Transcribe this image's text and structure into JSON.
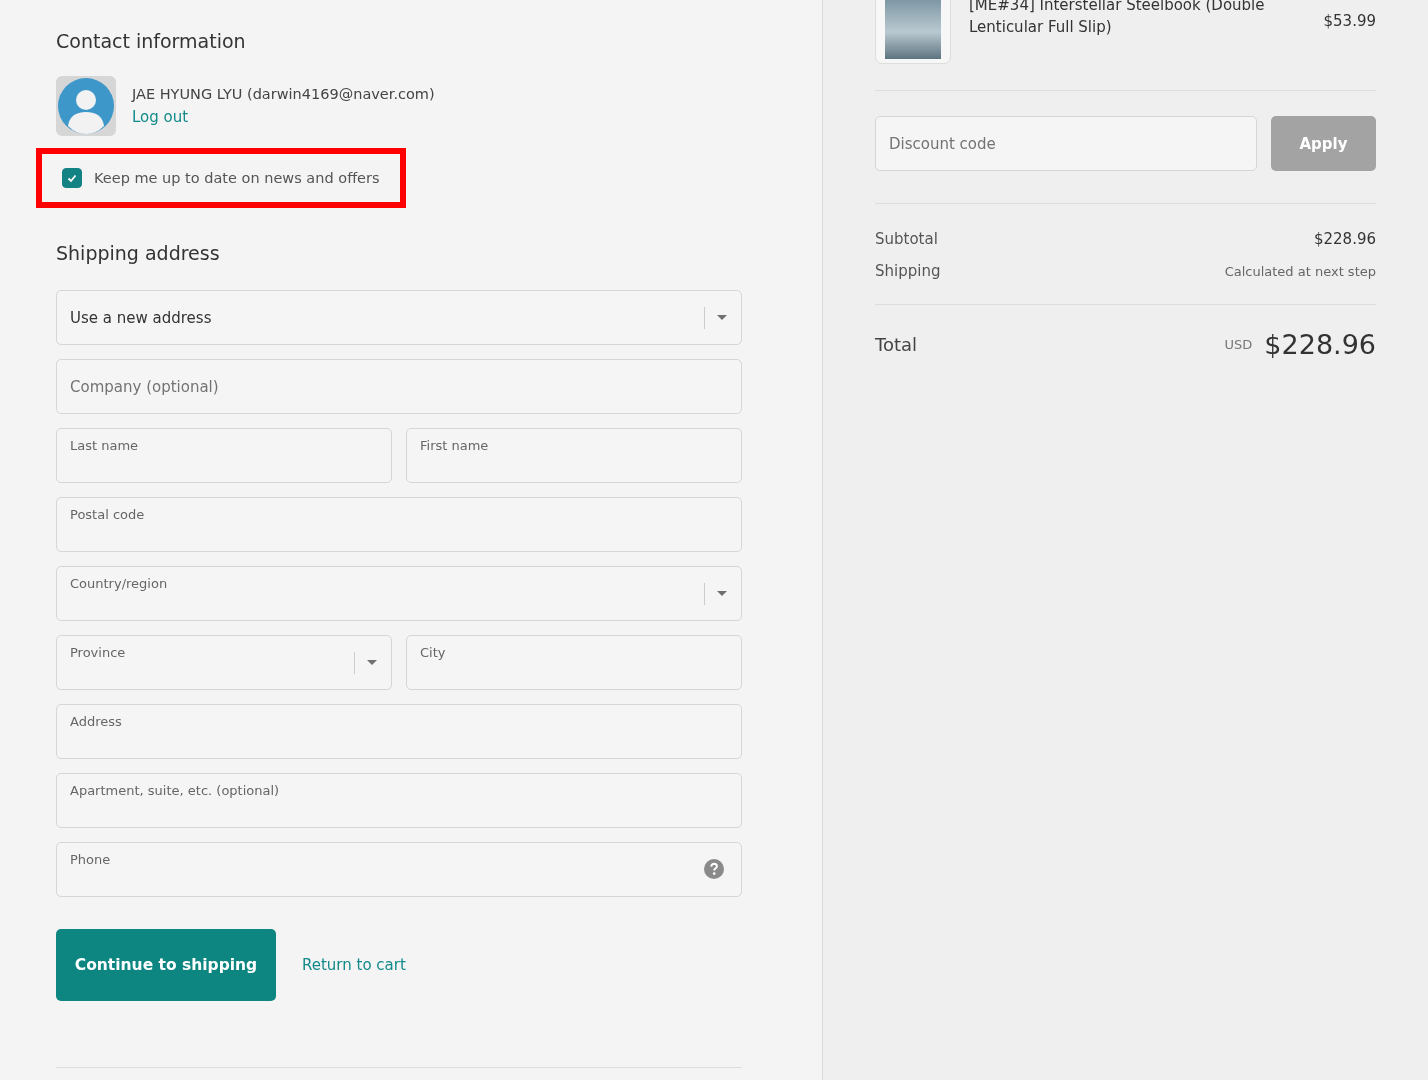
{
  "contact": {
    "title": "Contact information",
    "account": "JAE HYUNG LYU (darwin4169@naver.com)",
    "logout": "Log out",
    "newsletter": {
      "label": "Keep me up to date on news and offers",
      "checked": true,
      "highlighted": true
    }
  },
  "shipping": {
    "title": "Shipping address",
    "rows": [
      [
        {
          "kind": "select",
          "value": "Use a new address"
        }
      ],
      [
        {
          "kind": "input",
          "placeholder": "Company (optional)"
        }
      ],
      [
        {
          "kind": "input",
          "label": "Last name"
        },
        {
          "kind": "input",
          "label": "First name"
        }
      ],
      [
        {
          "kind": "input",
          "label": "Postal code"
        }
      ],
      [
        {
          "kind": "select",
          "label": "Country/region"
        }
      ],
      [
        {
          "kind": "select",
          "label": "Province"
        },
        {
          "kind": "input",
          "label": "City"
        }
      ],
      [
        {
          "kind": "input",
          "label": "Address"
        }
      ],
      [
        {
          "kind": "input",
          "label": "Apartment, suite, etc. (optional)"
        }
      ],
      [
        {
          "kind": "help",
          "label": "Phone"
        }
      ]
    ]
  },
  "actions": {
    "continue": "Continue to shipping",
    "return": "Return to cart"
  },
  "summary": {
    "product": {
      "name": "[ME#34] Interstellar Steelbook (Double Lenticular Full Slip)",
      "price": "$53.99"
    },
    "discount": {
      "placeholder": "Discount code",
      "button": "Apply",
      "disabled": true
    },
    "lines": [
      {
        "label": "Subtotal",
        "value": "$228.96",
        "kind": "amount"
      },
      {
        "label": "Shipping",
        "value": "Calculated at next step",
        "kind": "note"
      }
    ],
    "total": {
      "label": "Total",
      "currency": "USD",
      "amount": "$228.96"
    }
  }
}
